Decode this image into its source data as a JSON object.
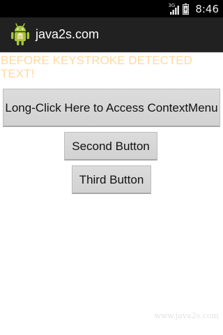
{
  "status_bar": {
    "network_type": "3G",
    "time": "8:46",
    "icons": [
      "signal-icon",
      "battery-icon"
    ]
  },
  "action_bar": {
    "icon": "android-app-icon",
    "title": "java2s.com"
  },
  "main": {
    "status_text": "BEFORE KEYSTROKE DETECTED TEXT!",
    "status_text_color": "#ffd9a0",
    "buttons": [
      {
        "label": "Long-Click Here to Access ContextMenu"
      },
      {
        "label": "Second Button"
      },
      {
        "label": "Third Button"
      }
    ]
  },
  "watermark": "www.java2s.com",
  "colors": {
    "status_bar_bg": "#000000",
    "action_bar_bg": "#212121",
    "button_bg": "#d6d6d6",
    "android_green": "#a4c639"
  }
}
